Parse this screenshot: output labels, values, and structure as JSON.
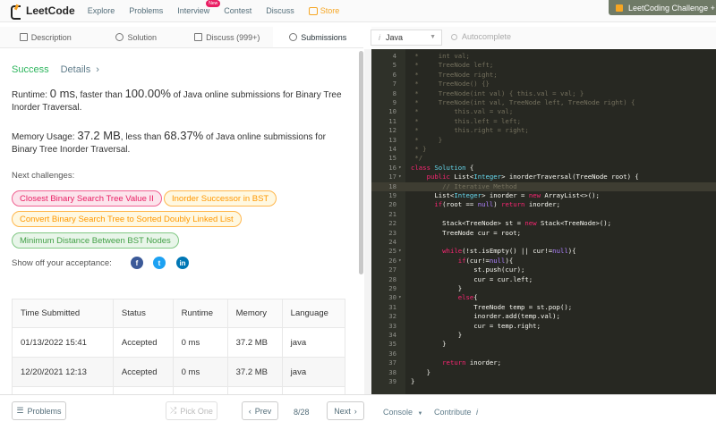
{
  "nav": {
    "brand": "LeetCode",
    "items": [
      {
        "name": "nav-explore",
        "label": "Explore"
      },
      {
        "name": "nav-problems",
        "label": "Problems"
      },
      {
        "name": "nav-interview",
        "label": "Interview"
      },
      {
        "name": "nav-contest",
        "label": "Contest"
      },
      {
        "name": "nav-discuss",
        "label": "Discuss"
      }
    ],
    "store": "Store",
    "interview_badge": "New",
    "promo": "LeetCoding Challenge + G"
  },
  "tabs": [
    "Description",
    "Solution",
    "Discuss (999+)",
    "Submissions"
  ],
  "result": {
    "status": "Success",
    "details": "Details",
    "runtime_prefix": "Runtime: ",
    "runtime_value": "0 ms",
    "runtime_mid": ", faster than ",
    "runtime_pct": "100.00%",
    "runtime_suffix": " of Java online submissions for Binary Tree Inorder Traversal.",
    "memory_prefix": "Memory Usage: ",
    "memory_value": "37.2 MB",
    "memory_mid": ", less than ",
    "memory_pct": "68.37%",
    "memory_suffix": " of Java online submissions for Binary Tree Inorder Traversal."
  },
  "next_label": "Next challenges:",
  "challenges": [
    {
      "label": "Closest Binary Search Tree Value II",
      "difficulty": "hard"
    },
    {
      "label": "Inorder Successor in BST",
      "difficulty": "medium"
    },
    {
      "label": "Convert Binary Search Tree to Sorted Doubly Linked List",
      "difficulty": "medium"
    },
    {
      "label": "Minimum Distance Between BST Nodes",
      "difficulty": "easy"
    }
  ],
  "share_label": "Show off your acceptance:",
  "table": {
    "headers": [
      "Time Submitted",
      "Status",
      "Runtime",
      "Memory",
      "Language"
    ],
    "rows": [
      [
        "01/13/2022 15:41",
        "Accepted",
        "0 ms",
        "37.2 MB",
        "java"
      ],
      [
        "12/20/2021 12:13",
        "Accepted",
        "0 ms",
        "37.2 MB",
        "java"
      ]
    ]
  },
  "bottom": {
    "problems": "Problems",
    "pick_one": "Pick One",
    "prev": "Prev",
    "page": "8/28",
    "next": "Next",
    "console": "Console",
    "contribute": "Contribute"
  },
  "editor": {
    "language": "Java",
    "autocomplete": "Autocomplete",
    "highlight_line": 19,
    "lines": [
      {
        "n": 4,
        "html": "<span class=\"c\"> *     int val;</span>"
      },
      {
        "n": 5,
        "html": "<span class=\"c\"> *     TreeNode left;</span>"
      },
      {
        "n": 6,
        "html": "<span class=\"c\"> *     TreeNode right;</span>"
      },
      {
        "n": 7,
        "html": "<span class=\"c\"> *     TreeNode() {}</span>"
      },
      {
        "n": 8,
        "html": "<span class=\"c\"> *     TreeNode(int val) { this.val = val; }</span>"
      },
      {
        "n": 9,
        "html": "<span class=\"c\"> *     TreeNode(int val, TreeNode left, TreeNode right) {</span>"
      },
      {
        "n": 10,
        "html": "<span class=\"c\"> *         this.val = val;</span>"
      },
      {
        "n": 11,
        "html": "<span class=\"c\"> *         this.left = left;</span>"
      },
      {
        "n": 12,
        "html": "<span class=\"c\"> *         this.right = right;</span>"
      },
      {
        "n": 13,
        "html": "<span class=\"c\"> *     }</span>"
      },
      {
        "n": 14,
        "html": "<span class=\"c\"> * }</span>"
      },
      {
        "n": 15,
        "html": "<span class=\"c\"> */</span>"
      },
      {
        "n": 16,
        "fold": true,
        "html": "<span class=\"k\">class</span> <span class=\"t\">Solution</span> {"
      },
      {
        "n": 17,
        "fold": true,
        "html": "    <span class=\"k\">public</span> List&lt;<span class=\"t\">Integer</span>&gt; inorderTraversal(TreeNode root) {"
      },
      {
        "n": 18,
        "html": "        <span class=\"c\">// Iterative Method</span>"
      },
      {
        "n": 19,
        "html": "      List&lt;<span class=\"t\">Integer</span>&gt; inorder = <span class=\"k\">new</span> ArrayList&lt;&gt;();"
      },
      {
        "n": 20,
        "html": "      <span class=\"k\">if</span>(root == <span class=\"n\">null</span>) <span class=\"k\">return</span> inorder;"
      },
      {
        "n": 21,
        "html": ""
      },
      {
        "n": 22,
        "html": "        Stack&lt;TreeNode&gt; st = <span class=\"k\">new</span> Stack&lt;TreeNode&gt;();"
      },
      {
        "n": 23,
        "html": "        TreeNode cur = root;"
      },
      {
        "n": 24,
        "html": ""
      },
      {
        "n": 25,
        "fold": true,
        "html": "        <span class=\"k\">while</span>(!st.isEmpty() || cur!=<span class=\"n\">null</span>){"
      },
      {
        "n": 26,
        "fold": true,
        "html": "            <span class=\"k\">if</span>(cur!=<span class=\"n\">null</span>){"
      },
      {
        "n": 27,
        "html": "                st.push(cur);"
      },
      {
        "n": 28,
        "html": "                cur = cur.left;"
      },
      {
        "n": 29,
        "html": "            }"
      },
      {
        "n": 30,
        "fold": true,
        "html": "            <span class=\"k\">else</span>{"
      },
      {
        "n": 31,
        "html": "                TreeNode temp = st.pop();"
      },
      {
        "n": 32,
        "html": "                inorder.add(temp.val);"
      },
      {
        "n": 33,
        "html": "                cur = temp.right;"
      },
      {
        "n": 34,
        "html": "            }"
      },
      {
        "n": 35,
        "html": "        }"
      },
      {
        "n": 36,
        "html": ""
      },
      {
        "n": 37,
        "html": "        <span class=\"k\">return</span> inorder;"
      },
      {
        "n": 38,
        "html": "    }"
      },
      {
        "n": 39,
        "html": "}"
      }
    ]
  }
}
